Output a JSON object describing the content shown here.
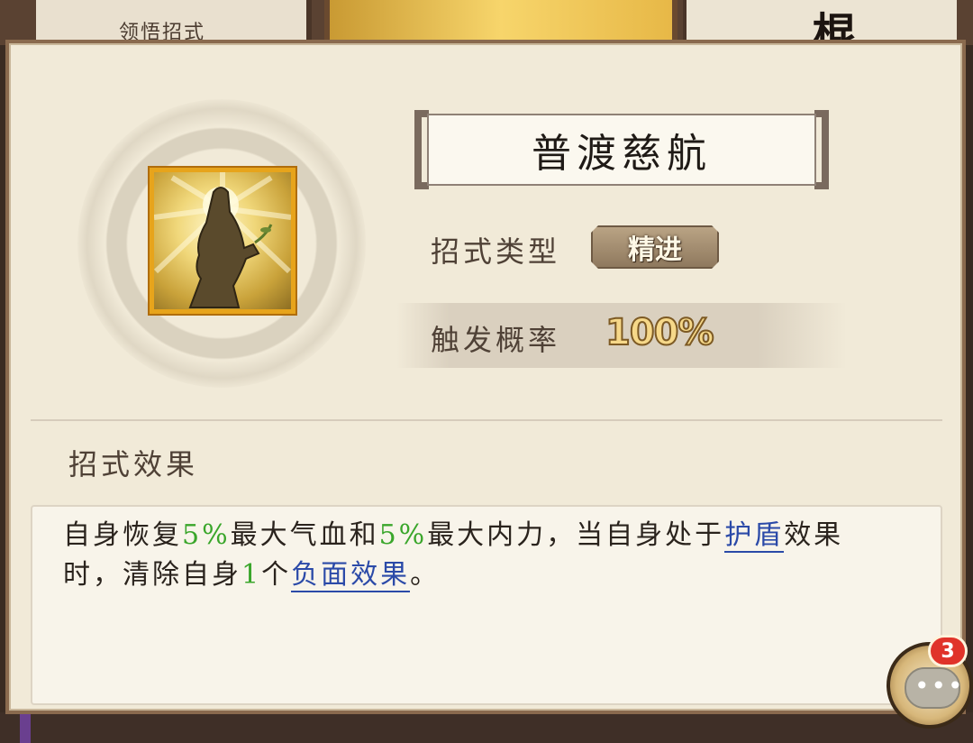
{
  "background": {
    "left_tab_label": "领悟招式",
    "right_tab_glyph": "棍"
  },
  "skill": {
    "name": "普渡慈航",
    "icon": "meditating-figure-icon",
    "type_label": "招式类型",
    "type_value": "精进",
    "rate_label": "触发概率",
    "rate_value": "100%"
  },
  "effect": {
    "heading": "招式效果",
    "segments": [
      {
        "text": "自身恢复",
        "style": "plain"
      },
      {
        "text": "5%",
        "style": "highlight"
      },
      {
        "text": "最大气血和",
        "style": "plain"
      },
      {
        "text": "5%",
        "style": "highlight"
      },
      {
        "text": "最大内力，当自身处于",
        "style": "plain"
      },
      {
        "text": "护盾",
        "style": "link"
      },
      {
        "text": "效果时，清除自身",
        "style": "plain"
      },
      {
        "text": "1",
        "style": "highlight"
      },
      {
        "text": "个",
        "style": "plain"
      },
      {
        "text": "负面效果",
        "style": "link"
      },
      {
        "text": "。",
        "style": "plain"
      }
    ],
    "colors": {
      "highlight": "#3aa62b",
      "link": "#2b4aa8"
    }
  },
  "chat": {
    "icon": "chat-bubble-icon",
    "unread_count": "3"
  }
}
